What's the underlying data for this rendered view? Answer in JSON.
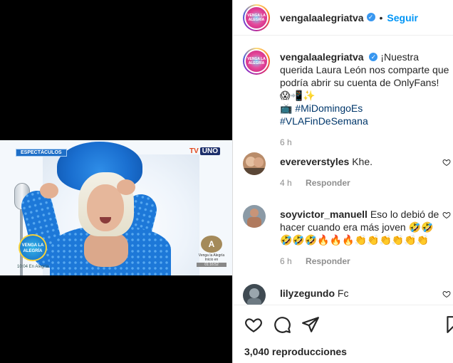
{
  "video": {
    "section_badge": "ESPECTÁCULOS",
    "network_logo": {
      "prefix": "TV",
      "name": "UNO"
    },
    "show_logo": "VENGA LA ALEGRÍA",
    "show_clock": "10:04 En Alegría",
    "corner_logo_letter": "A",
    "corner_caption": "Venga la Alegría Inicio en",
    "corner_time": "01:16:52"
  },
  "post": {
    "username": "vengalaalegriatva",
    "follow_label": "Seguir",
    "avatar_text": "VENGA LA ALEGRÍA",
    "caption": {
      "username": "vengalaalegriatva",
      "text": "¡Nuestra querida Laura León nos comparte que podría abrir su cuenta de OnlyFans! 😱📲✨",
      "line2_icon": "📺",
      "hashtag1": "#MiDomingoEs",
      "hashtag2": "#VLAFinDeSemana",
      "time": "6 h"
    },
    "comments": [
      {
        "username": "evereverstyles",
        "text": "Khe.",
        "time": "4 h",
        "reply_label": "Responder"
      },
      {
        "username": "soyvictor_manuell",
        "text": "Eso lo debió de hacer cuando era más joven 🤣🤣",
        "emoji_line": "🤣🤣🤣🔥🔥🔥👏👏👏👏👏👏",
        "time": "6 h",
        "reply_label": "Responder"
      },
      {
        "username": "lilyzegundo",
        "text": "Fc"
      }
    ],
    "views": "3,040 reproducciones"
  },
  "colors": {
    "link_blue": "#0095f6",
    "verified_blue": "#3897f0",
    "hashtag": "#00376b",
    "meta_gray": "#8e8e8e"
  },
  "icons": {
    "like": "heart-icon",
    "comment": "comment-icon",
    "share": "share-icon",
    "save": "bookmark-icon",
    "more": "more-options-icon"
  }
}
